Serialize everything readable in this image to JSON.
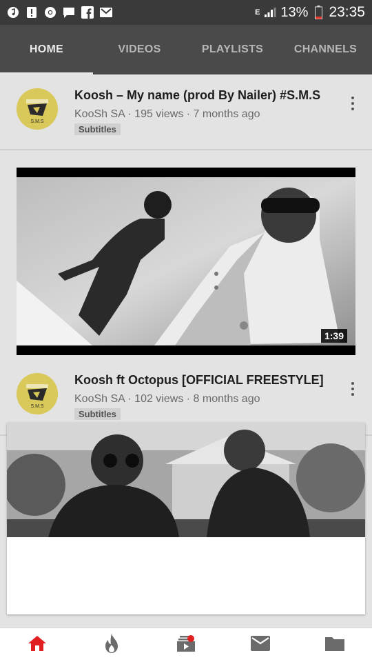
{
  "status_bar": {
    "battery": "13%",
    "time": "23:35",
    "network": "E"
  },
  "tabs": [
    {
      "label": "HOME",
      "active": true
    },
    {
      "label": "VIDEOS",
      "active": false
    },
    {
      "label": "PLAYLISTS",
      "active": false
    },
    {
      "label": "CHANNELS",
      "active": false
    }
  ],
  "videos": [
    {
      "title": "Koosh – My name (prod By Nailer) #S.M.S",
      "channel_line": "KooSh SA · 195 views · 7 months ago",
      "badge": "Subtitles",
      "duration": "1:39"
    },
    {
      "title": "Koosh ft Octopus [OFFICIAL FREESTYLE]",
      "channel_line": "KooSh SA · 102 views · 8 months ago",
      "badge": "Subtitles"
    }
  ],
  "avatar_text": "S.M.S",
  "colors": {
    "accent": "#e02020",
    "tabbar": "#4a4a4a",
    "statusbar": "#3a3a3a",
    "avatar": "#d9c85a"
  },
  "bottom_nav": [
    {
      "icon": "home-icon",
      "active": true
    },
    {
      "icon": "trending-icon",
      "active": false
    },
    {
      "icon": "subscriptions-icon",
      "active": false
    },
    {
      "icon": "inbox-icon",
      "active": false
    },
    {
      "icon": "library-icon",
      "active": false
    }
  ]
}
